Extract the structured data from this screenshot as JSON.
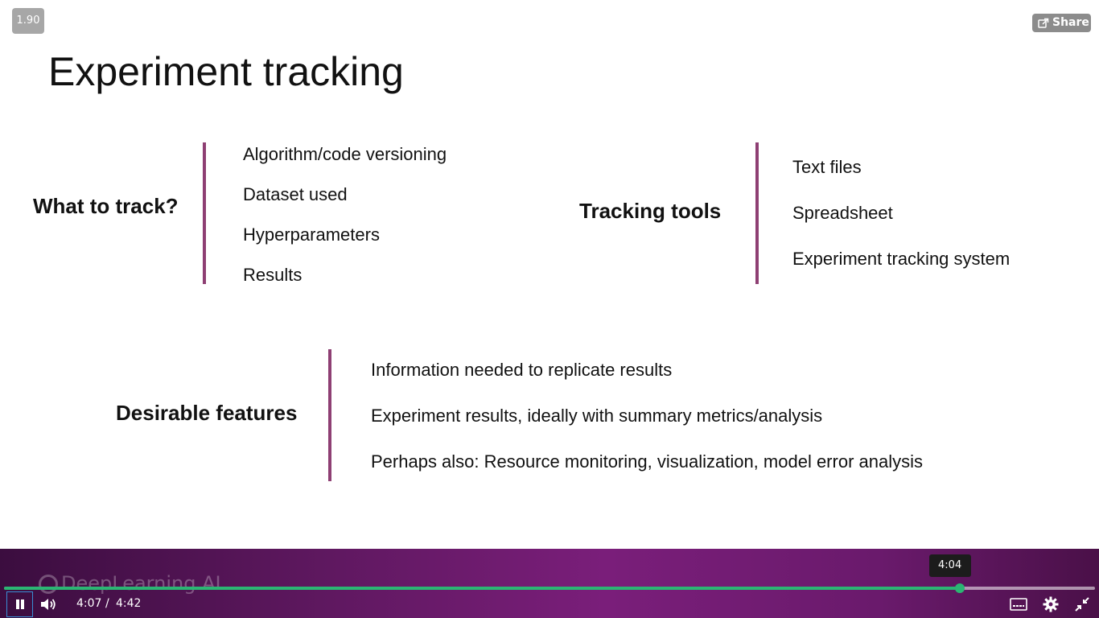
{
  "player": {
    "speed": "1.90",
    "share_label": "Share",
    "current_time": "4:07",
    "time_separator": "/",
    "duration": "4:42",
    "hover_time": "4:04",
    "progress_fraction": 0.876,
    "hover_fraction": 0.867,
    "watermark": "DeepLearning.AI",
    "accent_color": "#2bb673",
    "bar_color": "#8e3f73"
  },
  "slide": {
    "title": "Experiment tracking",
    "what_to_track": {
      "heading": "What to track?",
      "items": [
        "Algorithm/code versioning",
        "Dataset used",
        "Hyperparameters",
        "Results"
      ]
    },
    "tracking_tools": {
      "heading": "Tracking tools",
      "items": [
        "Text files",
        "Spreadsheet",
        "Experiment tracking system"
      ]
    },
    "desirable_features": {
      "heading": "Desirable features",
      "items": [
        "Information needed to replicate results",
        "Experiment results, ideally with summary metrics/analysis",
        "Perhaps also: Resource monitoring, visualization, model error analysis"
      ]
    }
  },
  "icons": {
    "share": "share-icon",
    "play_pause": "pause-icon",
    "volume": "volume-icon",
    "captions": "captions-icon",
    "settings": "gear-icon",
    "fullscreen": "exit-fullscreen-icon"
  }
}
